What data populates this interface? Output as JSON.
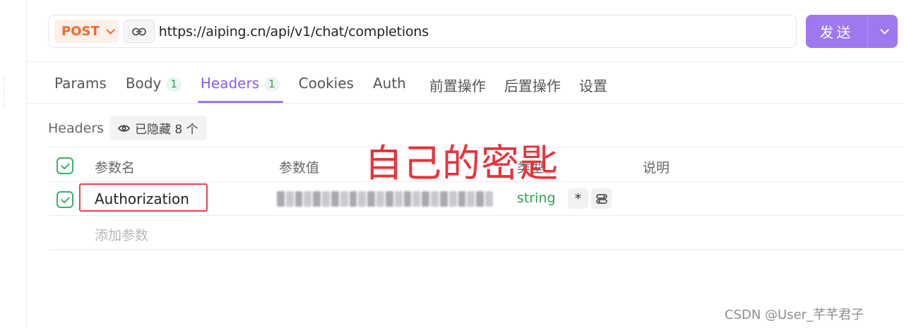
{
  "request": {
    "method": "POST",
    "url": "https://aiping.cn/api/v1/chat/completions",
    "send_label": "发送"
  },
  "tabs": [
    {
      "label": "Params",
      "badge": null
    },
    {
      "label": "Body",
      "badge": "1"
    },
    {
      "label": "Headers",
      "badge": "1",
      "active": true
    },
    {
      "label": "Cookies",
      "badge": null
    },
    {
      "label": "Auth",
      "badge": null
    },
    {
      "label": "前置操作",
      "badge": null
    },
    {
      "label": "后置操作",
      "badge": null
    },
    {
      "label": "设置",
      "badge": null
    }
  ],
  "headers_section": {
    "title": "Headers",
    "hidden_chip": "已隐藏 8 个"
  },
  "table": {
    "columns": {
      "name": "参数名",
      "value": "参数值",
      "type": "类型",
      "desc": "说明"
    },
    "rows": [
      {
        "name": "Authorization",
        "type": "string",
        "required": "*",
        "checked": true
      }
    ],
    "add_placeholder": "添加参数"
  },
  "annotation": "自己的密匙",
  "watermark": "CSDN @User_芊芊君子",
  "colors": {
    "accent": "#9e78ee",
    "method": "#f06a2c",
    "success": "#3bb06a",
    "annotation": "#e8323a"
  }
}
